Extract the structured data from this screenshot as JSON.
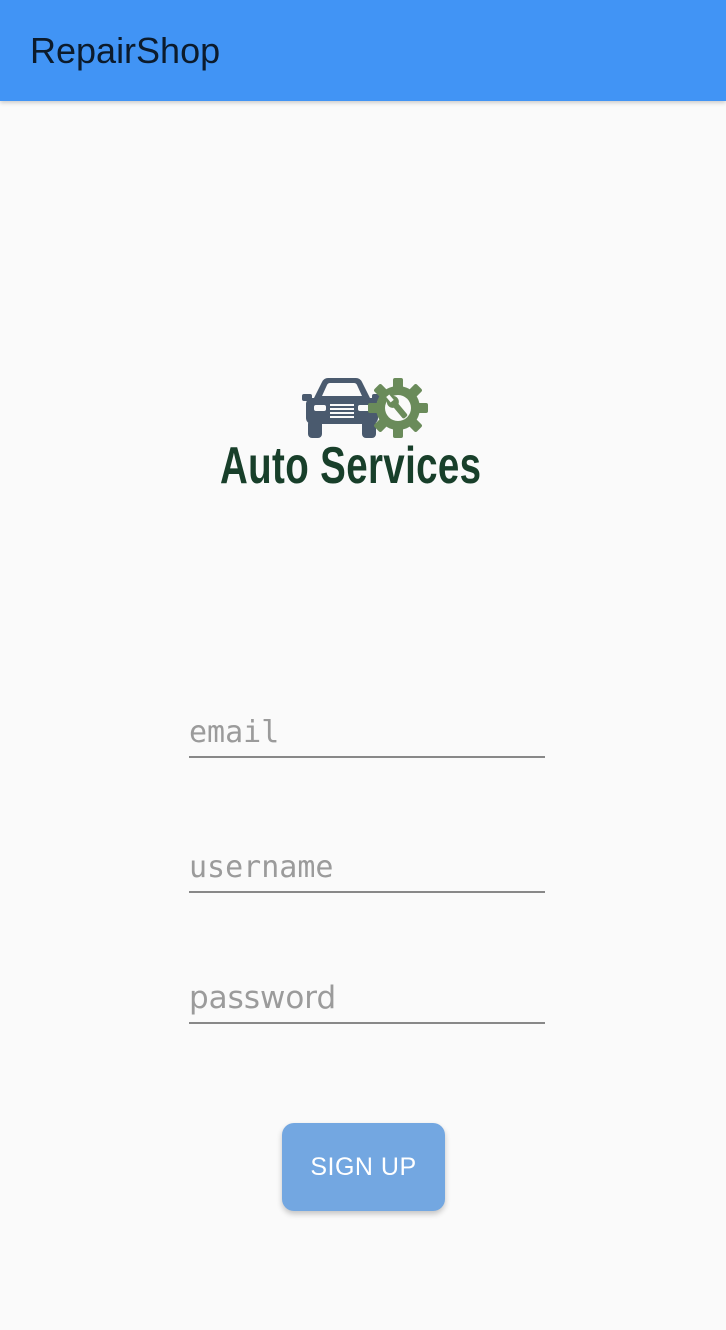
{
  "app_bar": {
    "title": "RepairShop",
    "color": "#4194f5"
  },
  "logo": {
    "text": "Auto Services",
    "icons": [
      "car-icon",
      "gear-wrench-icon"
    ],
    "text_color": "#183f2a"
  },
  "form": {
    "email": {
      "placeholder": "email",
      "value": ""
    },
    "username": {
      "placeholder": "username",
      "value": ""
    },
    "password": {
      "placeholder": "password",
      "value": ""
    },
    "signup_label": "SIGN UP",
    "button_color": "#73a7e1"
  }
}
